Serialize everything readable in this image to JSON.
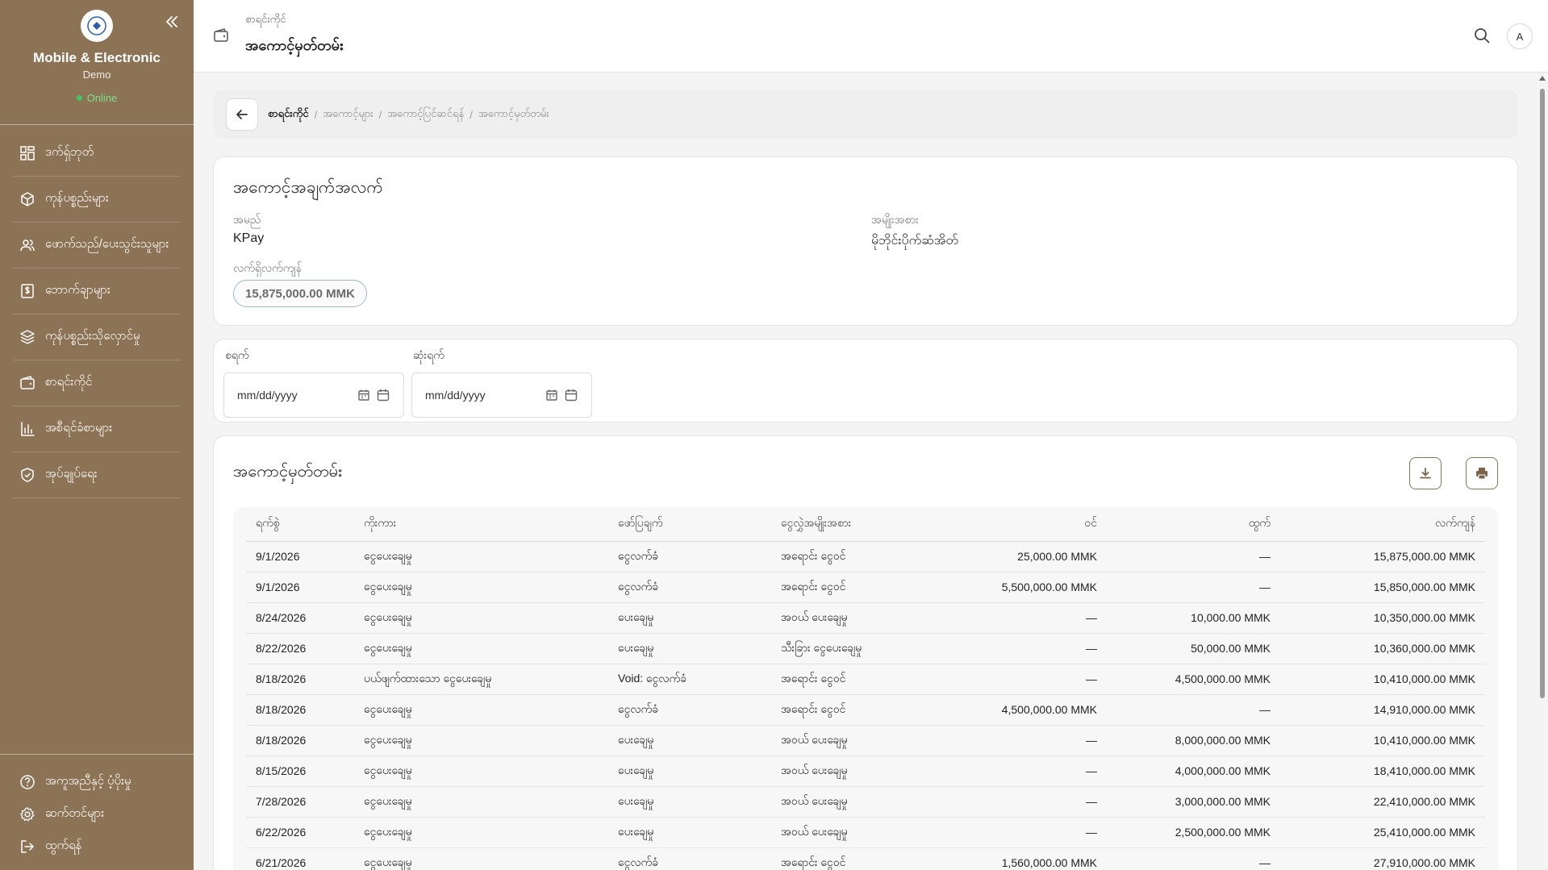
{
  "sidebar": {
    "company": "Mobile & Electronic",
    "plan": "Demo",
    "status": "Online",
    "nav": [
      {
        "label": "ဒက်ရှ်ဘုတ်",
        "icon": "dashboard-icon"
      },
      {
        "label": "ကုန်ပစ္စည်းများ",
        "icon": "box-icon"
      },
      {
        "label": "ဖောက်သည်/ပေးသွင်းသူများ",
        "icon": "users-icon"
      },
      {
        "label": "ဘောက်ချာများ",
        "icon": "receipt-icon"
      },
      {
        "label": "ကုန်ပစ္စည်းသိုလှောင်မှု",
        "icon": "layers-icon"
      },
      {
        "label": "စာရင်းကိုင်",
        "icon": "wallet-icon"
      },
      {
        "label": "အစီရင်ခံစာများ",
        "icon": "bar-chart-icon"
      },
      {
        "label": "အုပ်ချုပ်ရေး",
        "icon": "shield-icon"
      }
    ],
    "footer": [
      {
        "label": "အကူအညီနှင့် ပံ့ပိုးမှု",
        "icon": "help-icon"
      },
      {
        "label": "ဆက်တင်များ",
        "icon": "gear-icon"
      },
      {
        "label": "ထွက်ရန်",
        "icon": "logout-icon"
      }
    ]
  },
  "topbar": {
    "subtitle": "စာရင်းကိုင်",
    "title": "အကောင့်မှတ်တမ်း",
    "avatar": "A"
  },
  "breadcrumb": [
    "စာရင်းကိုင်",
    "အကောင့်များ",
    "အကောင့်ပြင်ဆင်ရန်",
    "အကောင့်မှတ်တမ်း"
  ],
  "account": {
    "heading": "အကောင့်အချက်အလက်",
    "name_label": "အမည်",
    "name": "KPay",
    "type_label": "အမျိုးအစား",
    "type": "မိုဘိုင်းပိုက်ဆံအိတ်",
    "balance_label": "လက်ရှိလက်ကျန်",
    "balance": "15,875,000.00 MMK"
  },
  "filters": {
    "start_label": "စရက်",
    "end_label": "ဆုံးရက်",
    "placeholder": "mm/dd/yyyy"
  },
  "ledger": {
    "heading": "အကောင့်မှတ်တမ်း",
    "columns": [
      "ရက်စွဲ",
      "ကိုးကား",
      "ဖော်ပြချက်",
      "ငွေလွှဲအမျိုးအစား",
      "ဝင်",
      "ထွက်",
      "လက်ကျန်"
    ],
    "rows": [
      [
        "9/1/2026",
        "ငွေပေးချေမှု",
        "ငွေလက်ခံ",
        "အရောင်း ငွေဝင်",
        "25,000.00 MMK",
        "—",
        "15,875,000.00 MMK"
      ],
      [
        "9/1/2026",
        "ငွေပေးချေမှု",
        "ငွေလက်ခံ",
        "အရောင်း ငွေဝင်",
        "5,500,000.00 MMK",
        "—",
        "15,850,000.00 MMK"
      ],
      [
        "8/24/2026",
        "ငွေပေးချေမှု",
        "ပေးချေမှု",
        "အဝယ် ပေးချေမှု",
        "—",
        "10,000.00 MMK",
        "10,350,000.00 MMK"
      ],
      [
        "8/22/2026",
        "ငွေပေးချေမှု",
        "ပေးချေမှု",
        "သီးခြား ငွေပေးချေမှု",
        "—",
        "50,000.00 MMK",
        "10,360,000.00 MMK"
      ],
      [
        "8/18/2026",
        "ပယ်ဖျက်ထားသော ငွေပေးချေမှု",
        "Void: ငွေလက်ခံ",
        "အရောင်း ငွေဝင်",
        "—",
        "4,500,000.00 MMK",
        "10,410,000.00 MMK"
      ],
      [
        "8/18/2026",
        "ငွေပေးချေမှု",
        "ငွေလက်ခံ",
        "အရောင်း ငွေဝင်",
        "4,500,000.00 MMK",
        "—",
        "14,910,000.00 MMK"
      ],
      [
        "8/18/2026",
        "ငွေပေးချေမှု",
        "ပေးချေမှု",
        "အဝယ် ပေးချေမှု",
        "—",
        "8,000,000.00 MMK",
        "10,410,000.00 MMK"
      ],
      [
        "8/15/2026",
        "ငွေပေးချေမှု",
        "ပေးချေမှု",
        "အဝယ် ပေးချေမှု",
        "—",
        "4,000,000.00 MMK",
        "18,410,000.00 MMK"
      ],
      [
        "7/28/2026",
        "ငွေပေးချေမှု",
        "ပေးချေမှု",
        "အဝယ် ပေးချေမှု",
        "—",
        "3,000,000.00 MMK",
        "22,410,000.00 MMK"
      ],
      [
        "6/22/2026",
        "ငွေပေးချေမှု",
        "ပေးချေမှု",
        "အဝယ် ပေးချေမှု",
        "—",
        "2,500,000.00 MMK",
        "25,410,000.00 MMK"
      ],
      [
        "6/21/2026",
        "ငွေပေးချေမှု",
        "ငွေလက်ခံ",
        "အရောင်း ငွေဝင်",
        "1,560,000.00 MMK",
        "—",
        "27,910,000.00 MMK"
      ]
    ]
  },
  "colors": {
    "sidebar_bg": "#8c7355",
    "accent": "#8c7355",
    "online": "#43c463"
  }
}
